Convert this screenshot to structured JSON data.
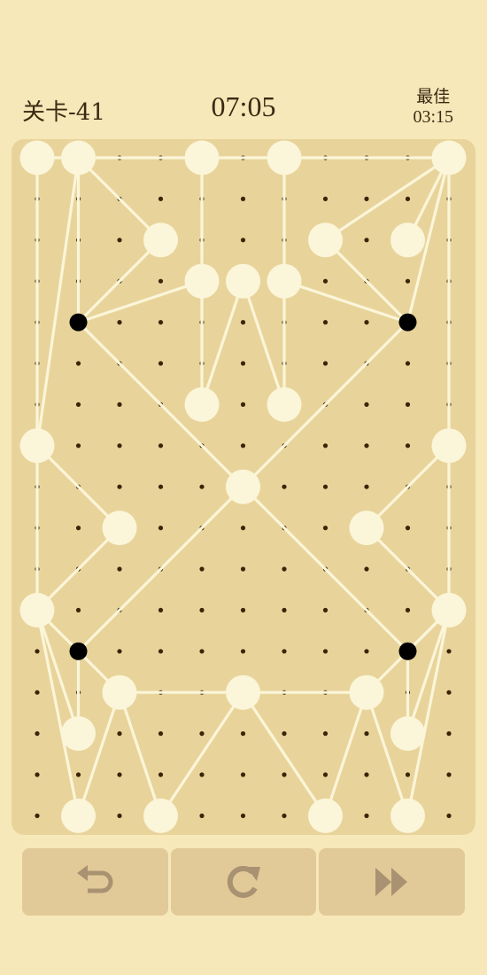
{
  "header": {
    "level_label": "关卡-41",
    "timer": "07:05",
    "best_label": "最佳",
    "best_time": "03:15"
  },
  "board": {
    "grid_cols": 11,
    "grid_rows": 17,
    "colors": {
      "board": "#e8d49b",
      "node": "#fbf5d9",
      "edge": "#fbf5d9",
      "dot": "#3b2508",
      "anchor": "#000000"
    },
    "nodes": [
      {
        "id": "A",
        "col": 0,
        "row": 0
      },
      {
        "id": "B",
        "col": 1,
        "row": 0
      },
      {
        "id": "C",
        "col": 4,
        "row": 0
      },
      {
        "id": "D",
        "col": 6,
        "row": 0
      },
      {
        "id": "E",
        "col": 10,
        "row": 0
      },
      {
        "id": "F",
        "col": 3,
        "row": 2
      },
      {
        "id": "G",
        "col": 7,
        "row": 2
      },
      {
        "id": "H",
        "col": 9,
        "row": 2
      },
      {
        "id": "I",
        "col": 4,
        "row": 3
      },
      {
        "id": "J",
        "col": 5,
        "row": 3
      },
      {
        "id": "K",
        "col": 6,
        "row": 3
      },
      {
        "id": "L",
        "col": 4,
        "row": 6
      },
      {
        "id": "M",
        "col": 6,
        "row": 6
      },
      {
        "id": "N",
        "col": 0,
        "row": 7
      },
      {
        "id": "O",
        "col": 10,
        "row": 7
      },
      {
        "id": "P",
        "col": 5,
        "row": 8
      },
      {
        "id": "Q",
        "col": 2,
        "row": 9
      },
      {
        "id": "R",
        "col": 8,
        "row": 9
      },
      {
        "id": "S",
        "col": 0,
        "row": 11
      },
      {
        "id": "T",
        "col": 10,
        "row": 11
      },
      {
        "id": "U",
        "col": 2,
        "row": 13
      },
      {
        "id": "V",
        "col": 5,
        "row": 13
      },
      {
        "id": "W",
        "col": 8,
        "row": 13
      },
      {
        "id": "X",
        "col": 1,
        "row": 14
      },
      {
        "id": "Y",
        "col": 9,
        "row": 14
      },
      {
        "id": "Z",
        "col": 1,
        "row": 16
      },
      {
        "id": "AA",
        "col": 3,
        "row": 16
      },
      {
        "id": "AB",
        "col": 7,
        "row": 16
      },
      {
        "id": "AC",
        "col": 9,
        "row": 16
      }
    ],
    "anchors": [
      {
        "id": "P1",
        "col": 1,
        "row": 4
      },
      {
        "id": "P2",
        "col": 9,
        "row": 4
      },
      {
        "id": "P3",
        "col": 1,
        "row": 12
      },
      {
        "id": "P4",
        "col": 9,
        "row": 12
      }
    ],
    "edges": [
      [
        "A",
        "B"
      ],
      [
        "B",
        "E"
      ],
      [
        "A",
        "S"
      ],
      [
        "B",
        "N"
      ],
      [
        "B",
        "P1"
      ],
      [
        "B",
        "F"
      ],
      [
        "F",
        "P1"
      ],
      [
        "C",
        "I"
      ],
      [
        "I",
        "L"
      ],
      [
        "P1",
        "I"
      ],
      [
        "J",
        "L"
      ],
      [
        "J",
        "M"
      ],
      [
        "D",
        "K"
      ],
      [
        "K",
        "M"
      ],
      [
        "K",
        "P2"
      ],
      [
        "G",
        "P2"
      ],
      [
        "E",
        "G"
      ],
      [
        "E",
        "H"
      ],
      [
        "E",
        "P2"
      ],
      [
        "E",
        "T"
      ],
      [
        "P1",
        "P"
      ],
      [
        "P2",
        "P"
      ],
      [
        "P",
        "P3"
      ],
      [
        "P",
        "P4"
      ],
      [
        "N",
        "Q"
      ],
      [
        "Q",
        "S"
      ],
      [
        "O",
        "R"
      ],
      [
        "R",
        "T"
      ],
      [
        "S",
        "P3"
      ],
      [
        "S",
        "X"
      ],
      [
        "S",
        "Z"
      ],
      [
        "P3",
        "U"
      ],
      [
        "P3",
        "X"
      ],
      [
        "U",
        "V"
      ],
      [
        "V",
        "W"
      ],
      [
        "U",
        "Z"
      ],
      [
        "U",
        "AA"
      ],
      [
        "V",
        "AA"
      ],
      [
        "V",
        "AB"
      ],
      [
        "W",
        "AB"
      ],
      [
        "W",
        "AC"
      ],
      [
        "W",
        "T"
      ],
      [
        "P4",
        "T"
      ],
      [
        "P4",
        "Y"
      ],
      [
        "Y",
        "T"
      ],
      [
        "AC",
        "T"
      ]
    ]
  },
  "controls": {
    "undo": "undo-icon",
    "restart": "restart-icon",
    "skip": "fast-forward-icon",
    "icon_color": "#a89272"
  }
}
